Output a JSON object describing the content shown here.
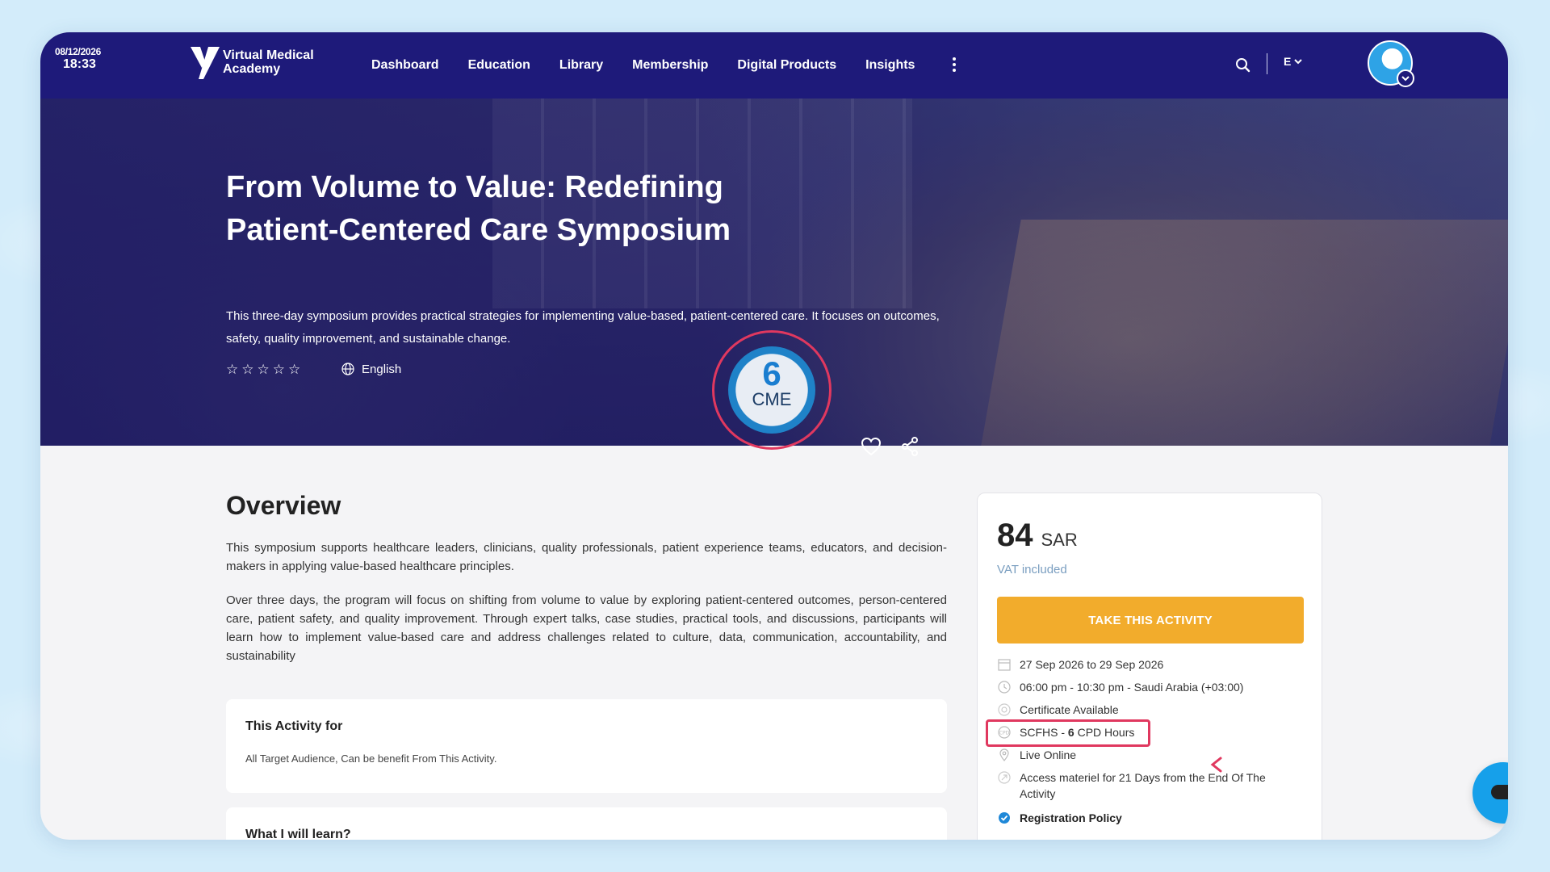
{
  "header": {
    "date": "08/12/2026",
    "time": "18:33",
    "logo_text": [
      "Virtual Medical",
      "Academy"
    ],
    "nav": [
      "Dashboard",
      "Education",
      "Library",
      "Membership",
      "Digital Products",
      "Insights"
    ],
    "lang": "E",
    "icons": [
      "search-icon",
      "more-icon",
      "chevron-down-icon",
      "avatar"
    ]
  },
  "hero": {
    "title": "From Volume to Value: Redefining Patient-Centered Care Symposium",
    "description": "This three-day symposium provides practical strategies for implementing value-based, patient-centered care. It focuses on outcomes, safety, quality improvement, and sustainable change.",
    "rating_stars": 0,
    "language": "English",
    "cme_value": "6",
    "cme_label": "CME"
  },
  "overview": {
    "heading": "Overview",
    "p1": "This symposium supports healthcare leaders, clinicians, quality professionals, patient experience teams, educators, and decision-makers in applying value-based healthcare principles.",
    "p2": "Over three days, the program will focus on shifting from volume to value by exploring patient-centered outcomes, person-centered care, patient safety, and quality improvement. Through expert talks, case studies, practical tools, and discussions, participants will learn how to implement value-based care and address challenges related to culture, data, communication, accountability, and sustainability"
  },
  "cards": {
    "activity_for_title": "This Activity for",
    "activity_for_text": "All Target Audience, Can be benefit From This Activity.",
    "learn_title": "What I will learn?"
  },
  "pricing": {
    "amount": "84",
    "currency": "SAR",
    "vat": "VAT included",
    "button": "TAKE THIS ACTIVITY",
    "dates": "27 Sep 2026 to 29 Sep 2026",
    "time": "06:00 pm - 10:30 pm - Saudi Arabia (+03:00)",
    "certificate": "Certificate Available",
    "cpd_prefix": "SCFHS - ",
    "cpd_value": "6",
    "cpd_suffix": " CPD Hours",
    "mode": "Live Online",
    "access": "Access materiel for 21 Days from the End Of The Activity",
    "policy": "Registration Policy"
  },
  "colors": {
    "nav_bg": "#1e1a7a",
    "accent_button": "#f2ac2c",
    "highlight": "#e0385f",
    "chat": "#16a0ea"
  }
}
